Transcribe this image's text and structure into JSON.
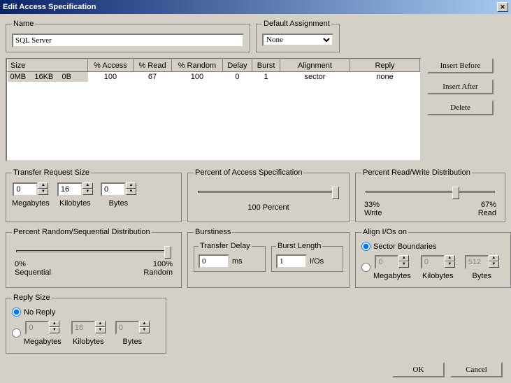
{
  "title": "Edit Access Specification",
  "name": {
    "label": "Name",
    "value": "SQL Server"
  },
  "default_assignment": {
    "label": "Default Assignment",
    "value": "None"
  },
  "table": {
    "headers": [
      "Size",
      "% Access",
      "% Read",
      "% Random",
      "Delay",
      "Burst",
      "Alignment",
      "Reply"
    ],
    "row": {
      "size": "0MB    16KB    0B",
      "access": "100",
      "read": "67",
      "random": "100",
      "delay": "0",
      "burst": "1",
      "alignment": "sector",
      "reply": "none"
    }
  },
  "buttons": {
    "insert_before": "Insert Before",
    "insert_after": "Insert After",
    "delete": "Delete",
    "ok": "OK",
    "cancel": "Cancel"
  },
  "transfer_size": {
    "legend": "Transfer Request Size",
    "mb": {
      "value": "0",
      "label": "Megabytes"
    },
    "kb": {
      "value": "16",
      "label": "Kilobytes"
    },
    "b": {
      "value": "0",
      "label": "Bytes"
    }
  },
  "percent_access": {
    "legend": "Percent of Access Specification",
    "label": "100 Percent",
    "pos": 100
  },
  "read_write": {
    "legend": "Percent Read/Write Distribution",
    "left": "33%",
    "left_sub": "Write",
    "right": "67%",
    "right_sub": "Read",
    "pos": 67
  },
  "random_seq": {
    "legend": "Percent Random/Sequential Distribution",
    "left": "0%",
    "left_sub": "Sequential",
    "right": "100%",
    "right_sub": "Random",
    "pos": 100
  },
  "burstiness": {
    "legend": "Burstiness",
    "delay": {
      "legend": "Transfer Delay",
      "value": "0",
      "unit": "ms"
    },
    "length": {
      "legend": "Burst Length",
      "value": "1",
      "unit": "I/Os"
    }
  },
  "align": {
    "legend": "Align I/Os on",
    "sector": "Sector Boundaries",
    "mb": {
      "value": "0",
      "label": "Megabytes"
    },
    "kb": {
      "value": "0",
      "label": "Kilobytes"
    },
    "b": {
      "value": "512",
      "label": "Bytes"
    }
  },
  "reply": {
    "legend": "Reply Size",
    "no_reply": "No Reply",
    "mb": {
      "value": "0",
      "label": "Megabytes"
    },
    "kb": {
      "value": "16",
      "label": "Kilobytes"
    },
    "b": {
      "value": "0",
      "label": "Bytes"
    }
  }
}
